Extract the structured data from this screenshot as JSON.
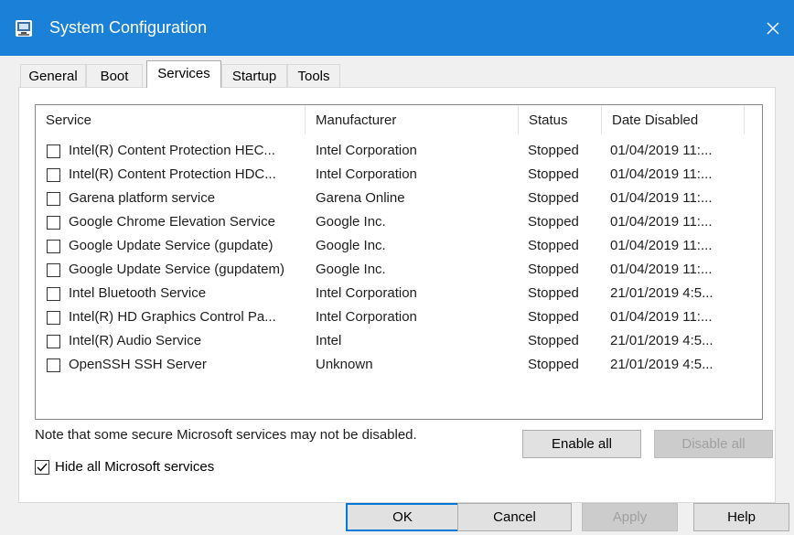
{
  "window": {
    "title": "System Configuration",
    "close_glyph": "✕",
    "icon": "msconfig-icon"
  },
  "tabs": [
    {
      "label": "General"
    },
    {
      "label": "Boot"
    },
    {
      "label": "Services",
      "active": true
    },
    {
      "label": "Startup"
    },
    {
      "label": "Tools"
    }
  ],
  "table": {
    "columns": [
      "Service",
      "Manufacturer",
      "Status",
      "Date Disabled"
    ],
    "rows": [
      {
        "service": "Intel(R) Content Protection HEC...",
        "manufacturer": "Intel Corporation",
        "status": "Stopped",
        "date": "01/04/2019 11:..."
      },
      {
        "service": "Intel(R) Content Protection HDC...",
        "manufacturer": "Intel Corporation",
        "status": "Stopped",
        "date": "01/04/2019 11:..."
      },
      {
        "service": "Garena platform service",
        "manufacturer": "Garena Online",
        "status": "Stopped",
        "date": "01/04/2019 11:..."
      },
      {
        "service": "Google Chrome Elevation Service",
        "manufacturer": "Google Inc.",
        "status": "Stopped",
        "date": "01/04/2019 11:..."
      },
      {
        "service": "Google Update Service (gupdate)",
        "manufacturer": "Google Inc.",
        "status": "Stopped",
        "date": "01/04/2019 11:..."
      },
      {
        "service": "Google Update Service (gupdatem)",
        "manufacturer": "Google Inc.",
        "status": "Stopped",
        "date": "01/04/2019 11:..."
      },
      {
        "service": "Intel Bluetooth Service",
        "manufacturer": "Intel Corporation",
        "status": "Stopped",
        "date": "21/01/2019 4:5..."
      },
      {
        "service": "Intel(R) HD Graphics Control Pa...",
        "manufacturer": "Intel Corporation",
        "status": "Stopped",
        "date": "01/04/2019 11:..."
      },
      {
        "service": "Intel(R) Audio Service",
        "manufacturer": "Intel",
        "status": "Stopped",
        "date": "21/01/2019 4:5..."
      },
      {
        "service": "OpenSSH SSH Server",
        "manufacturer": "Unknown",
        "status": "Stopped",
        "date": "21/01/2019 4:5..."
      }
    ]
  },
  "note": "Note that some secure Microsoft services may not be disabled.",
  "buttons": {
    "enable_all": "Enable all",
    "disable_all": "Disable all",
    "ok": "OK",
    "cancel": "Cancel",
    "apply": "Apply",
    "help": "Help"
  },
  "hide_ms": {
    "label": "Hide all Microsoft services",
    "checked": true
  },
  "colors": {
    "titlebar": "#1a80d8",
    "dialog_bg": "#f0f0f0"
  }
}
